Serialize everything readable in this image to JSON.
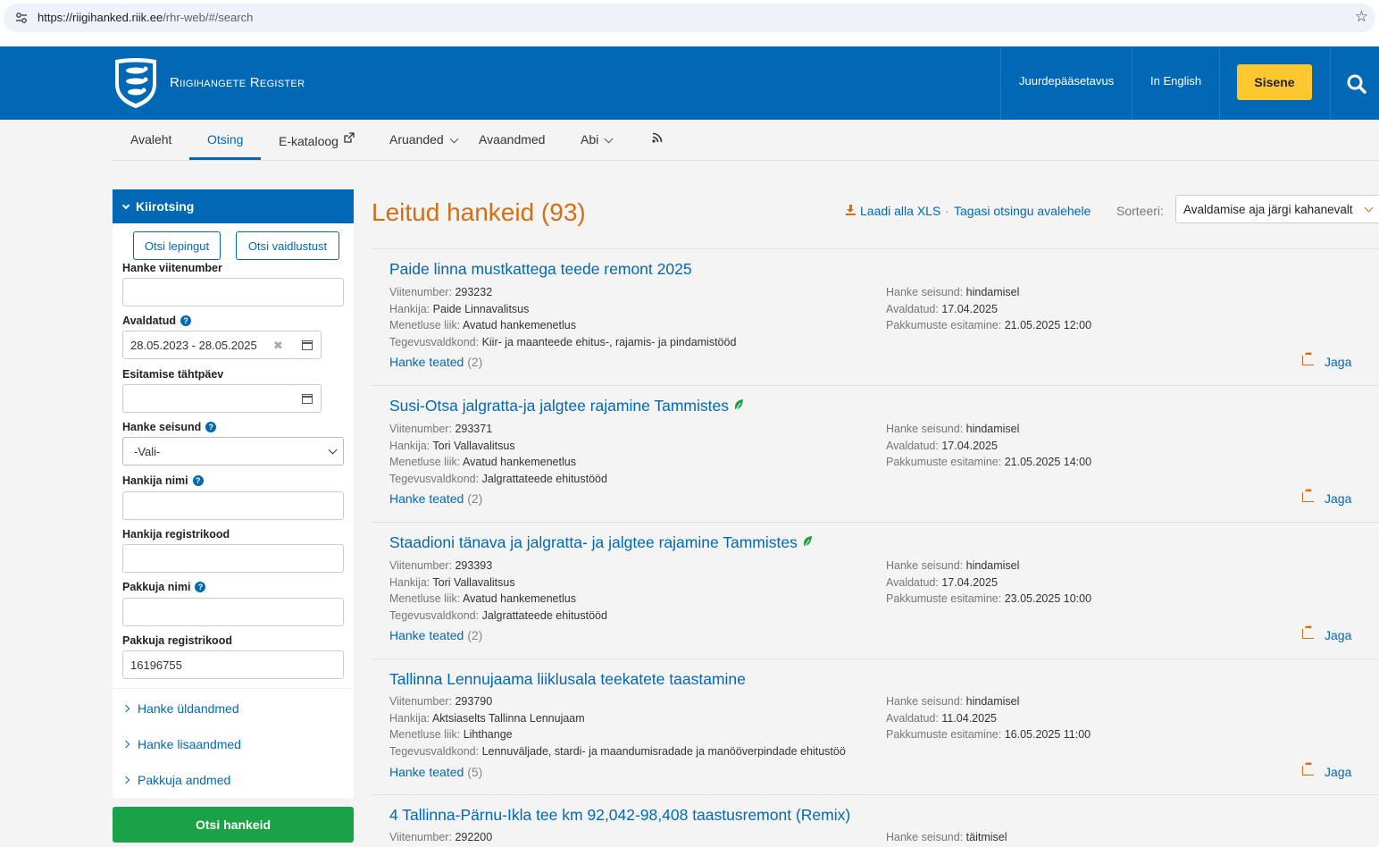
{
  "browser": {
    "url_host": "https://riigihanked.riik.ee",
    "url_path": "/rhr-web/#/search"
  },
  "header": {
    "brand": "Riigihangete Register",
    "links": [
      "Juurdepääsetavus",
      "In English"
    ],
    "login_label": "Sisene"
  },
  "nav": {
    "items": [
      "Avaleht",
      "Otsing",
      "E-kataloog",
      "Aruanded",
      "Avaandmed",
      "Abi"
    ],
    "active": "Otsing"
  },
  "sidebar": {
    "title": "Kiirotsing",
    "btn_contracts": "Otsi lepingut",
    "btn_disputes": "Otsi vaidlustust",
    "fields": {
      "reference_label": "Hanke viitenumber",
      "reference_value": "",
      "published_label": "Avaldatud",
      "published_value": "28.05.2023 - 28.05.2025",
      "deadline_label": "Esitamise tähtpäev",
      "deadline_value": "",
      "status_label": "Hanke seisund",
      "status_value": "-Vali-",
      "buyer_name_label": "Hankija nimi",
      "buyer_name_value": "",
      "buyer_code_label": "Hankija registrikood",
      "buyer_code_value": "",
      "bidder_name_label": "Pakkuja nimi",
      "bidder_name_value": "",
      "bidder_code_label": "Pakkuja registrikood",
      "bidder_code_value": "16196755"
    },
    "accordions": [
      "Hanke üldandmed",
      "Hanke lisaandmed",
      "Pakkuja andmed"
    ],
    "search_button": "Otsi hankeid"
  },
  "results": {
    "title": "Leitud hankeid (93)",
    "download_label": "Laadi alla XLS",
    "back_label": "Tagasi otsingu avalehele",
    "sort_label": "Sorteeri:",
    "sort_value": "Avaldamise aja järgi kahanevalt",
    "labels": {
      "ref": "Viitenumber:",
      "buyer": "Hankija:",
      "procedure": "Menetluse liik:",
      "field": "Tegevusvaldkond:",
      "status": "Hanke seisund:",
      "published": "Avaldatud:",
      "deadline": "Pakkumuste esitamine:",
      "notices": "Hanke teated",
      "share": "Jaga"
    },
    "items": [
      {
        "title": "Paide linna mustkattega teede remont 2025",
        "green": false,
        "ref": "293232",
        "buyer": "Paide Linnavalitsus",
        "procedure": "Avatud hankemenetlus",
        "field": "Kiir- ja maanteede ehitus-, rajamis- ja pindamistööd",
        "status": "hindamisel",
        "published": "17.04.2025",
        "deadline": "21.05.2025 12:00",
        "notices_count": "(2)"
      },
      {
        "title": "Susi-Otsa jalgratta-ja jalgtee rajamine Tammistes",
        "green": true,
        "ref": "293371",
        "buyer": "Tori Vallavalitsus",
        "procedure": "Avatud hankemenetlus",
        "field": "Jalgrattateede ehitustööd",
        "status": "hindamisel",
        "published": "17.04.2025",
        "deadline": "21.05.2025 14:00",
        "notices_count": "(2)"
      },
      {
        "title": "Staadioni tänava ja jalgratta- ja jalgtee rajamine Tammistes",
        "green": true,
        "ref": "293393",
        "buyer": "Tori Vallavalitsus",
        "procedure": "Avatud hankemenetlus",
        "field": "Jalgrattateede ehitustööd",
        "status": "hindamisel",
        "published": "17.04.2025",
        "deadline": "23.05.2025 10:00",
        "notices_count": "(2)"
      },
      {
        "title": "Tallinna Lennujaama liiklusala teekatete taastamine",
        "green": false,
        "ref": "293790",
        "buyer": "Aktsiaselts Tallinna Lennujaam",
        "procedure": "Lihthange",
        "field": "Lennuväljade, stardi- ja maandumisradade ja manööverpindade ehitustöö",
        "status": "hindamisel",
        "published": "11.04.2025",
        "deadline": "16.05.2025 11:00",
        "notices_count": "(5)"
      },
      {
        "title": "4 Tallinna-Pärnu-Ikla tee km 92,042-98,408 taastusremont (Remix)",
        "green": false,
        "ref": "292200",
        "status": "täitmisel"
      }
    ]
  },
  "colors": {
    "brand_blue": "#0068b5",
    "accent_orange": "#d36e14",
    "login_yellow": "#fdc82f",
    "search_green": "#1aa246"
  },
  "icons": [
    "site-settings-icon",
    "bookmark-star-icon",
    "coat-of-arms-logo",
    "search-icon",
    "external-link-icon",
    "chevron-down-icon",
    "rss-icon",
    "help-icon",
    "calendar-icon",
    "clear-icon",
    "download-icon",
    "leaf-icon",
    "share-icon"
  ]
}
